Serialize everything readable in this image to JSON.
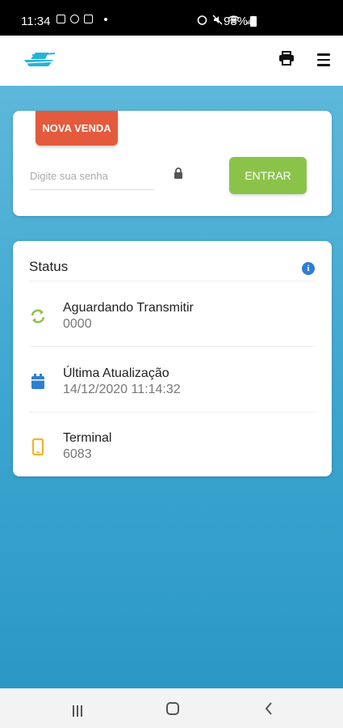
{
  "status_bar": {
    "time": "11:34",
    "battery": "98%"
  },
  "appbar": {
    "logo_icon": "ship-logo-icon",
    "print_icon": "printer-icon",
    "menu_icon": "hamburger-menu-icon"
  },
  "venda": {
    "badge": "NOVA VENDA",
    "password_placeholder": "Digite sua senha",
    "password_value": "",
    "enter_button": "ENTRAR"
  },
  "status": {
    "title": "Status",
    "info_icon": "info-icon",
    "items": [
      {
        "icon": "sync-icon",
        "label": "Aguardando Transmitir",
        "value": "0000",
        "color": "#8bc34a"
      },
      {
        "icon": "calendar-icon",
        "label": "Última Atualização",
        "value": "14/12/2020 11:14:32",
        "color": "#2f7fd1"
      },
      {
        "icon": "phone-icon",
        "label": "Terminal",
        "value": "6083",
        "color": "#f0b429"
      }
    ]
  },
  "colors": {
    "accent": "#e45a3d",
    "button": "#8bc34a",
    "background": "#3aa6cf"
  }
}
